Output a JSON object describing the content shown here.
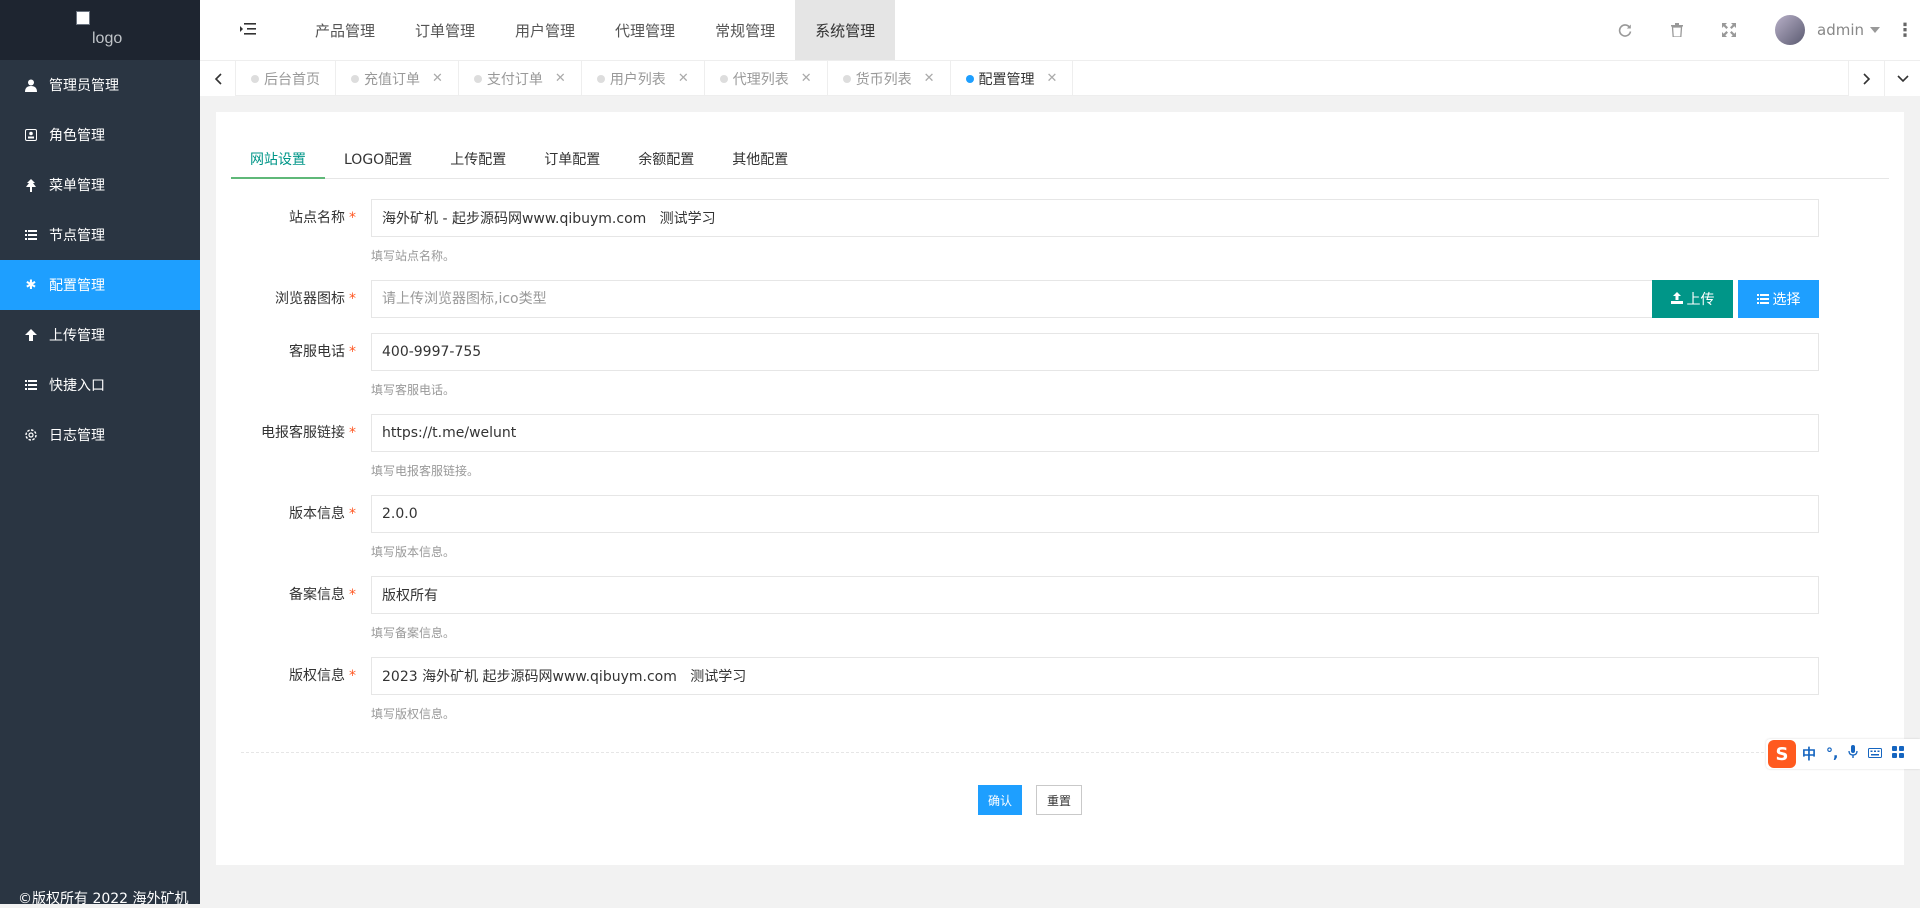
{
  "sidebar": {
    "logo_alt": "logo",
    "items": [
      {
        "label": "管理员管理",
        "icon": "user-icon",
        "active": false
      },
      {
        "label": "角色管理",
        "icon": "role-icon",
        "active": false
      },
      {
        "label": "菜单管理",
        "icon": "tree-icon",
        "active": false
      },
      {
        "label": "节点管理",
        "icon": "list-icon",
        "active": false
      },
      {
        "label": "配置管理",
        "icon": "asterisk-icon",
        "active": true
      },
      {
        "label": "上传管理",
        "icon": "arrow-up-icon",
        "active": false
      },
      {
        "label": "快捷入口",
        "icon": "list-icon",
        "active": false
      },
      {
        "label": "日志管理",
        "icon": "gear-icon",
        "active": false
      }
    ],
    "copyright": "©版权所有 2022 海外矿机"
  },
  "header": {
    "nav": [
      {
        "label": "产品管理",
        "active": false
      },
      {
        "label": "订单管理",
        "active": false
      },
      {
        "label": "用户管理",
        "active": false
      },
      {
        "label": "代理管理",
        "active": false
      },
      {
        "label": "常规管理",
        "active": false
      },
      {
        "label": "系统管理",
        "active": true
      }
    ],
    "user_name": "admin",
    "icons": [
      "refresh-icon",
      "trash-icon",
      "fullscreen-icon",
      "more-icon"
    ]
  },
  "tabs": [
    {
      "label": "后台首页",
      "closable": false,
      "active": false
    },
    {
      "label": "充值订单",
      "closable": true,
      "active": false
    },
    {
      "label": "支付订单",
      "closable": true,
      "active": false
    },
    {
      "label": "用户列表",
      "closable": true,
      "active": false
    },
    {
      "label": "代理列表",
      "closable": true,
      "active": false
    },
    {
      "label": "货币列表",
      "closable": true,
      "active": false
    },
    {
      "label": "配置管理",
      "closable": true,
      "active": true
    }
  ],
  "config_tabs": [
    {
      "label": "网站设置",
      "active": true
    },
    {
      "label": "LOGO配置",
      "active": false
    },
    {
      "label": "上传配置",
      "active": false
    },
    {
      "label": "订单配置",
      "active": false
    },
    {
      "label": "余额配置",
      "active": false
    },
    {
      "label": "其他配置",
      "active": false
    }
  ],
  "form": {
    "site_name": {
      "label": "站点名称",
      "value": "海外矿机 - 起步源码网www.qibuym.com   测试学习",
      "help": "填写站点名称。"
    },
    "favicon": {
      "label": "浏览器图标",
      "value": "",
      "placeholder": "请上传浏览器图标,ico类型",
      "upload_label": "上传",
      "select_label": "选择"
    },
    "service_phone": {
      "label": "客服电话",
      "value": "400-9997-755",
      "help": "填写客服电话。"
    },
    "telegram_link": {
      "label": "电报客服链接",
      "value": "https://t.me/welunt",
      "help": "填写电报客服链接。"
    },
    "version": {
      "label": "版本信息",
      "value": "2.0.0",
      "help": "填写版本信息。"
    },
    "icp": {
      "label": "备案信息",
      "value": "版权所有",
      "help": "填写备案信息。"
    },
    "copyright": {
      "label": "版权信息",
      "value": "2023 海外矿机 起步源码网www.qibuym.com   测试学习",
      "help": "填写版权信息。"
    },
    "required_mark": "*",
    "confirm_label": "确认",
    "reset_label": "重置"
  },
  "ime": {
    "logo": "S",
    "items": [
      "中",
      "°,",
      "🎤",
      "⌨",
      "▦"
    ]
  },
  "colors": {
    "primary": "#1e9fff",
    "success": "#009688",
    "sidebar": "#2a3542",
    "required": "#ff5722"
  }
}
